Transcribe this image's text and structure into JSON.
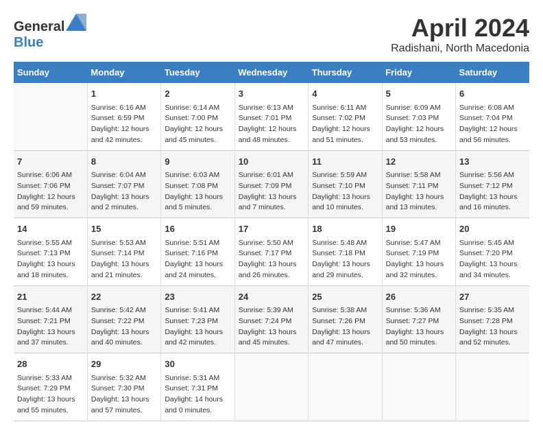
{
  "header": {
    "logo_general": "General",
    "logo_blue": "Blue",
    "title": "April 2024",
    "subtitle": "Radishani, North Macedonia"
  },
  "columns": [
    "Sunday",
    "Monday",
    "Tuesday",
    "Wednesday",
    "Thursday",
    "Friday",
    "Saturday"
  ],
  "weeks": [
    [
      {
        "day": "",
        "info": ""
      },
      {
        "day": "1",
        "info": "Sunrise: 6:16 AM\nSunset: 6:59 PM\nDaylight: 12 hours\nand 42 minutes."
      },
      {
        "day": "2",
        "info": "Sunrise: 6:14 AM\nSunset: 7:00 PM\nDaylight: 12 hours\nand 45 minutes."
      },
      {
        "day": "3",
        "info": "Sunrise: 6:13 AM\nSunset: 7:01 PM\nDaylight: 12 hours\nand 48 minutes."
      },
      {
        "day": "4",
        "info": "Sunrise: 6:11 AM\nSunset: 7:02 PM\nDaylight: 12 hours\nand 51 minutes."
      },
      {
        "day": "5",
        "info": "Sunrise: 6:09 AM\nSunset: 7:03 PM\nDaylight: 12 hours\nand 53 minutes."
      },
      {
        "day": "6",
        "info": "Sunrise: 6:08 AM\nSunset: 7:04 PM\nDaylight: 12 hours\nand 56 minutes."
      }
    ],
    [
      {
        "day": "7",
        "info": "Sunrise: 6:06 AM\nSunset: 7:06 PM\nDaylight: 12 hours\nand 59 minutes."
      },
      {
        "day": "8",
        "info": "Sunrise: 6:04 AM\nSunset: 7:07 PM\nDaylight: 13 hours\nand 2 minutes."
      },
      {
        "day": "9",
        "info": "Sunrise: 6:03 AM\nSunset: 7:08 PM\nDaylight: 13 hours\nand 5 minutes."
      },
      {
        "day": "10",
        "info": "Sunrise: 6:01 AM\nSunset: 7:09 PM\nDaylight: 13 hours\nand 7 minutes."
      },
      {
        "day": "11",
        "info": "Sunrise: 5:59 AM\nSunset: 7:10 PM\nDaylight: 13 hours\nand 10 minutes."
      },
      {
        "day": "12",
        "info": "Sunrise: 5:58 AM\nSunset: 7:11 PM\nDaylight: 13 hours\nand 13 minutes."
      },
      {
        "day": "13",
        "info": "Sunrise: 5:56 AM\nSunset: 7:12 PM\nDaylight: 13 hours\nand 16 minutes."
      }
    ],
    [
      {
        "day": "14",
        "info": "Sunrise: 5:55 AM\nSunset: 7:13 PM\nDaylight: 13 hours\nand 18 minutes."
      },
      {
        "day": "15",
        "info": "Sunrise: 5:53 AM\nSunset: 7:14 PM\nDaylight: 13 hours\nand 21 minutes."
      },
      {
        "day": "16",
        "info": "Sunrise: 5:51 AM\nSunset: 7:16 PM\nDaylight: 13 hours\nand 24 minutes."
      },
      {
        "day": "17",
        "info": "Sunrise: 5:50 AM\nSunset: 7:17 PM\nDaylight: 13 hours\nand 26 minutes."
      },
      {
        "day": "18",
        "info": "Sunrise: 5:48 AM\nSunset: 7:18 PM\nDaylight: 13 hours\nand 29 minutes."
      },
      {
        "day": "19",
        "info": "Sunrise: 5:47 AM\nSunset: 7:19 PM\nDaylight: 13 hours\nand 32 minutes."
      },
      {
        "day": "20",
        "info": "Sunrise: 5:45 AM\nSunset: 7:20 PM\nDaylight: 13 hours\nand 34 minutes."
      }
    ],
    [
      {
        "day": "21",
        "info": "Sunrise: 5:44 AM\nSunset: 7:21 PM\nDaylight: 13 hours\nand 37 minutes."
      },
      {
        "day": "22",
        "info": "Sunrise: 5:42 AM\nSunset: 7:22 PM\nDaylight: 13 hours\nand 40 minutes."
      },
      {
        "day": "23",
        "info": "Sunrise: 5:41 AM\nSunset: 7:23 PM\nDaylight: 13 hours\nand 42 minutes."
      },
      {
        "day": "24",
        "info": "Sunrise: 5:39 AM\nSunset: 7:24 PM\nDaylight: 13 hours\nand 45 minutes."
      },
      {
        "day": "25",
        "info": "Sunrise: 5:38 AM\nSunset: 7:26 PM\nDaylight: 13 hours\nand 47 minutes."
      },
      {
        "day": "26",
        "info": "Sunrise: 5:36 AM\nSunset: 7:27 PM\nDaylight: 13 hours\nand 50 minutes."
      },
      {
        "day": "27",
        "info": "Sunrise: 5:35 AM\nSunset: 7:28 PM\nDaylight: 13 hours\nand 52 minutes."
      }
    ],
    [
      {
        "day": "28",
        "info": "Sunrise: 5:33 AM\nSunset: 7:29 PM\nDaylight: 13 hours\nand 55 minutes."
      },
      {
        "day": "29",
        "info": "Sunrise: 5:32 AM\nSunset: 7:30 PM\nDaylight: 13 hours\nand 57 minutes."
      },
      {
        "day": "30",
        "info": "Sunrise: 5:31 AM\nSunset: 7:31 PM\nDaylight: 14 hours\nand 0 minutes."
      },
      {
        "day": "",
        "info": ""
      },
      {
        "day": "",
        "info": ""
      },
      {
        "day": "",
        "info": ""
      },
      {
        "day": "",
        "info": ""
      }
    ]
  ]
}
